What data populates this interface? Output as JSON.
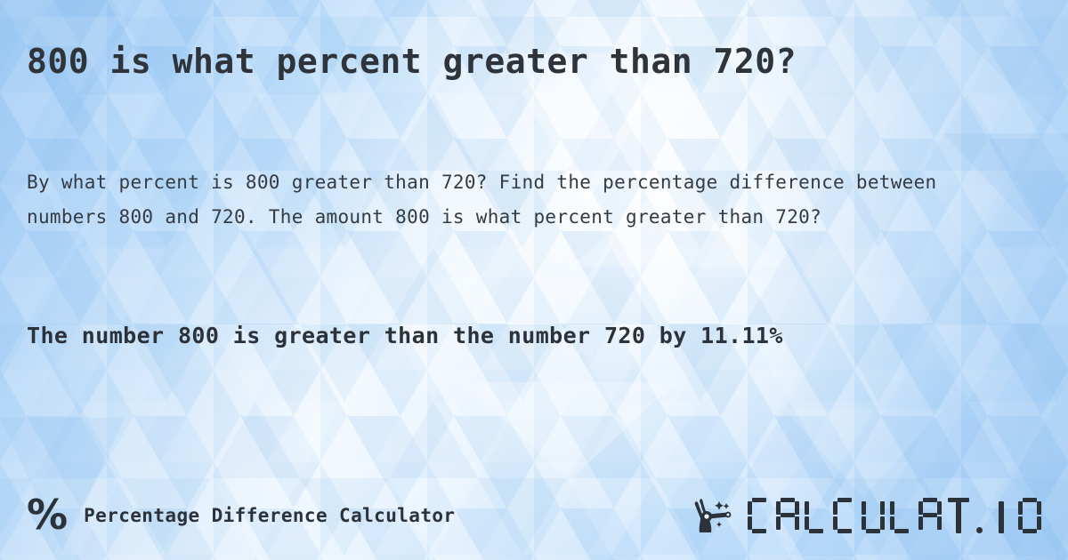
{
  "page": {
    "title": "800 is what percent greater than 720?",
    "description": "By what percent is 800 greater than 720? Find the percentage difference between numbers 800 and 720. The amount 800 is what percent greater than 720?",
    "result": "The number 800 is greater than the number 720 by 11.11%"
  },
  "values": {
    "number_a": "800",
    "number_b": "720",
    "percent_difference": "11.11%"
  },
  "footer": {
    "percent_symbol": "%",
    "calculator_name": "Percentage Difference Calculator",
    "logo_text": "CALCULAT.IO",
    "logo_icon": "hand-magic-wand-icon"
  },
  "colors": {
    "title_text": "#2e3439",
    "body_text": "#343b42",
    "result_text": "#2b3239",
    "background_light": "#e4f1fd",
    "background_mid": "#c3e0fb",
    "background_deep": "#a6cef5"
  }
}
